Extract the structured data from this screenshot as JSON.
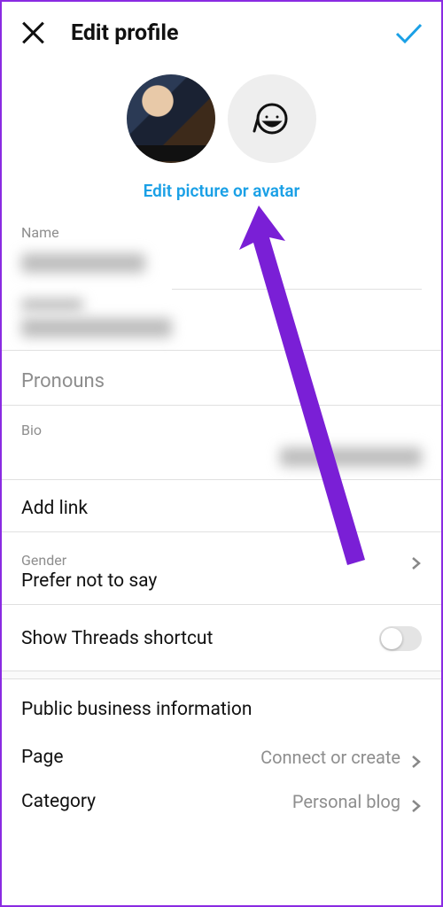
{
  "header": {
    "title": "Edit profile"
  },
  "avatarAction": "Edit picture or avatar",
  "fields": {
    "nameLabel": "Name",
    "pronounsLabel": "Pronouns",
    "bioLabel": "Bio",
    "addLink": "Add link",
    "genderLabel": "Gender",
    "genderValue": "Prefer not to say",
    "threadsLabel": "Show Threads shortcut",
    "threadsOn": false
  },
  "business": {
    "header": "Public business information",
    "pageLabel": "Page",
    "pageValue": "Connect or create",
    "categoryLabel": "Category",
    "categoryValue": "Personal blog"
  },
  "icons": {
    "close": "close-icon",
    "confirm": "check-icon",
    "avatarEmoji": "avatar-emoji-icon",
    "chevron": "chevron-right-icon"
  }
}
